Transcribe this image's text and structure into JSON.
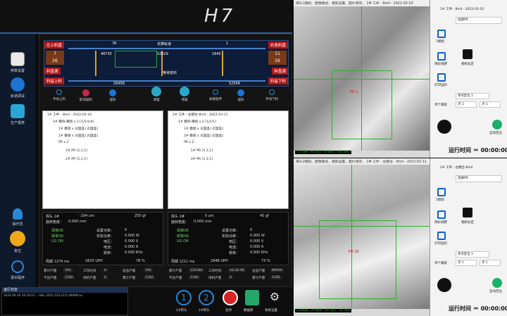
{
  "header": {
    "logo_text": "H7"
  },
  "sidebar": {
    "items": [
      {
        "label": "参数设置"
      },
      {
        "label": "轨道调试"
      },
      {
        "label": "生产报表"
      },
      {
        "label": "操作员"
      },
      {
        "label": "复位"
      },
      {
        "label": "退出程序"
      }
    ]
  },
  "track": {
    "top_left_label": "左上料盘",
    "top_right_label": "右收料盘",
    "left_mid_label": "料盘满",
    "right_mid_label": "料盘满",
    "left_bottom_label": "料盒上料",
    "right_bottom_label": "料盒下料",
    "support_speed_label": "支撑轨道",
    "wait_label": "等待进料",
    "left_top_value": "7",
    "left_mid_value": "26",
    "right_top_value": "11",
    "right_mid_value": "26",
    "top_center_value": "78",
    "top_right_value": "1",
    "node_1": "48735",
    "node_2": "52029",
    "node_3": "1845",
    "node_bottom_left": "29458",
    "node_bottom_right": "52599"
  },
  "toolbar": {
    "buttons": [
      {
        "label": "手动上料"
      },
      {
        "label": "取消送料"
      },
      {
        "label": "送料"
      },
      {
        "label": "清理"
      },
      {
        "label": "清理"
      },
      {
        "label": "关联程序"
      },
      {
        "label": "送料"
      },
      {
        "label": "手动下料"
      }
    ]
  },
  "tree_left": {
    "title": "1# 工件 - 8mil - 2022-03-10",
    "items": [
      "1# 模块-模组 x 2 [1/1/1/4]",
      "1# 模组 x 3[固晶] 2[固晶]",
      "2# 模组 x 3[固晶] 2[固晶]",
      "PR x 2",
      "1# PR [1,1,1]",
      "2# PR [1,1,1]"
    ]
  },
  "tree_right": {
    "title": "2# 工件 - 左模台-8mil - 2022-03-11",
    "items": [
      "1# 模块-模组 x 2 [1/1/1]",
      "1# 模组 x 3[固晶] 2[固晶]",
      "2# 模组 x 3[固晶] 2[固晶]",
      "PR x 2",
      "1# PR [1,1,1]",
      "2# PR [1,1,1]"
    ]
  },
  "info_left": {
    "head_label": "焊头 1#",
    "head_value": "-294 um",
    "head_force": "255 gf",
    "angle_label": "旋转角度：",
    "angle_value": "0.000 mm",
    "status": [
      "焊接OK",
      "频率OK",
      "UG ON"
    ],
    "set_power_label": "设置功率：",
    "set_power_value": "0",
    "real_power_label": "实际功率：",
    "real_power_value": "0.000 W",
    "voltage_label": "电压：",
    "voltage_value": "0.000 V",
    "current_label": "电流：",
    "current_value": "0.000 A",
    "freq_label": "频率：",
    "freq_value": "0.000 KHz",
    "cycle": "周期 1274 ms",
    "uph": "2825 UPH",
    "percent": "78 %"
  },
  "info_right": {
    "head_label": "焊头 2#",
    "head_value": "0 um",
    "head_force": "45 gf",
    "angle_label": "旋转角度：",
    "angle_value": "0.000 mm",
    "status": [
      "焊接OK",
      "频率OK",
      "UG ON"
    ],
    "set_power_label": "设置功率：",
    "set_power_value": "0",
    "real_power_label": "实际功率：",
    "real_power_value": "0.000 W",
    "voltage_label": "电压：",
    "voltage_value": "0.000 V",
    "current_label": "电流：",
    "current_value": "0.000 A",
    "freq_label": "频率：",
    "freq_value": "0.000 KHz",
    "cycle": "周期 1211 ms",
    "uph": "2948 UPH",
    "percent": "73 %"
  },
  "stats_left": {
    "row1": [
      "累计产量",
      "792",
      "工作时间",
      "0",
      "良品产量",
      "792"
    ],
    "row2": [
      "不良产量",
      "1182",
      "待机产量",
      "0",
      "累计产量",
      "1182"
    ]
  },
  "stats_right": {
    "row1": [
      "累计产量",
      "120184",
      "工作时间",
      "43:42:58",
      "良品产量",
      "89546"
    ],
    "row2": [
      "不良产量",
      "1182",
      "待机产量",
      "0",
      "累计产量",
      "1182"
    ]
  },
  "bottom": {
    "log_title": "运行日志",
    "log_line": "2022-06-16 16:18:53 :: GBL:1025:120:1215 WARN xx",
    "buttons": [
      {
        "label": "1",
        "caption": "1#焊头"
      },
      {
        "label": "2",
        "caption": "2#焊头"
      },
      {
        "label": "",
        "caption": "急停"
      },
      {
        "label": "",
        "caption": "数据库"
      },
      {
        "label": "",
        "caption": "系统设置"
      }
    ]
  },
  "camera_top": {
    "toolbar": "焊头1相机、图像模式、相机设置、图片保存、 2# 工件 - 8mil - 2022-03-10",
    "marker": "PR 1",
    "readout": "72.599 , 44.647 : 0.060 , 456.987",
    "panel_title": "1# 工件 - 8mil - 2022-03-10",
    "panel_select": "选择PR",
    "buttons": [
      "1模组",
      "目标视野",
      "相机标定",
      "打印运料",
      "单个跟踪",
      "自动定位"
    ],
    "selects": [
      "单点定位 1",
      "点 1",
      "点 1"
    ],
    "run_label": "运行时间 ＝ 00:00:00"
  },
  "camera_bottom": {
    "toolbar": "焊头2相机、图像模式、相机设置、图片保存、 2# 工件 - 左模台 - 8mil - 2022-03-11",
    "marker": "PR 18",
    "readout": "23.858 , 35.660 : 10.702 , 52.565",
    "panel_title": "2# 工件 - 左模台-8mil",
    "panel_select": "选择PR",
    "buttons": [
      "1模组",
      "目标视野",
      "相机标定",
      "打印运料",
      "单个跟踪",
      "自动定位"
    ],
    "selects": [
      "单点定位 1",
      "点 1",
      "点 1"
    ],
    "run_label": "运行时间 ＝ 00:00:00"
  }
}
